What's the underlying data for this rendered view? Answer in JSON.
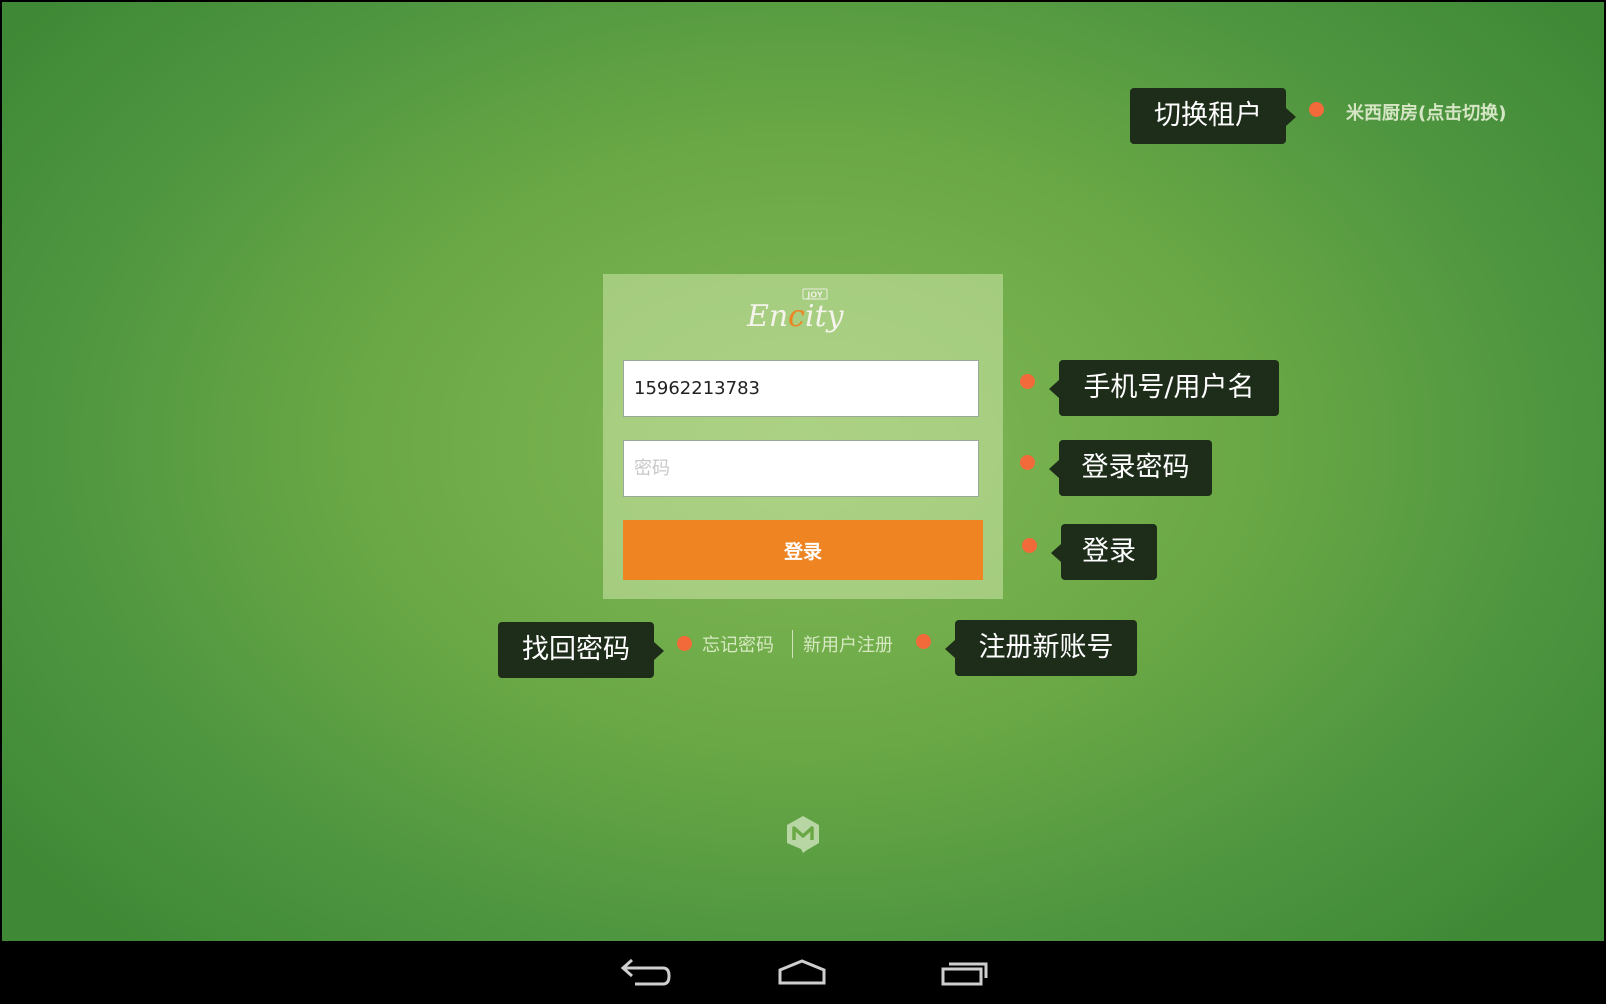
{
  "tenant": {
    "link_label": "米西厨房(点击切换)"
  },
  "login_form": {
    "logo_text": "EnCity",
    "logo_badge": "JOY",
    "phone_value": "15962213783",
    "password_placeholder": "密码",
    "login_button_label": "登录"
  },
  "links": {
    "forgot_password": "忘记密码",
    "register": "新用户注册"
  },
  "callouts": {
    "tenant": "切换租户",
    "phone": "手机号/用户名",
    "password": "登录密码",
    "login": "登录",
    "forgot": "找回密码",
    "register": "注册新账号"
  },
  "icons": {
    "brand": "brand-m-icon",
    "back": "back-icon",
    "home": "home-icon",
    "recents": "recents-icon"
  },
  "colors": {
    "background_center": "#83b958",
    "background_edge": "#3f8936",
    "login_button": "#ee8422",
    "callout_bg": "#1d2d1a",
    "callout_dot": "#f26a3a"
  }
}
